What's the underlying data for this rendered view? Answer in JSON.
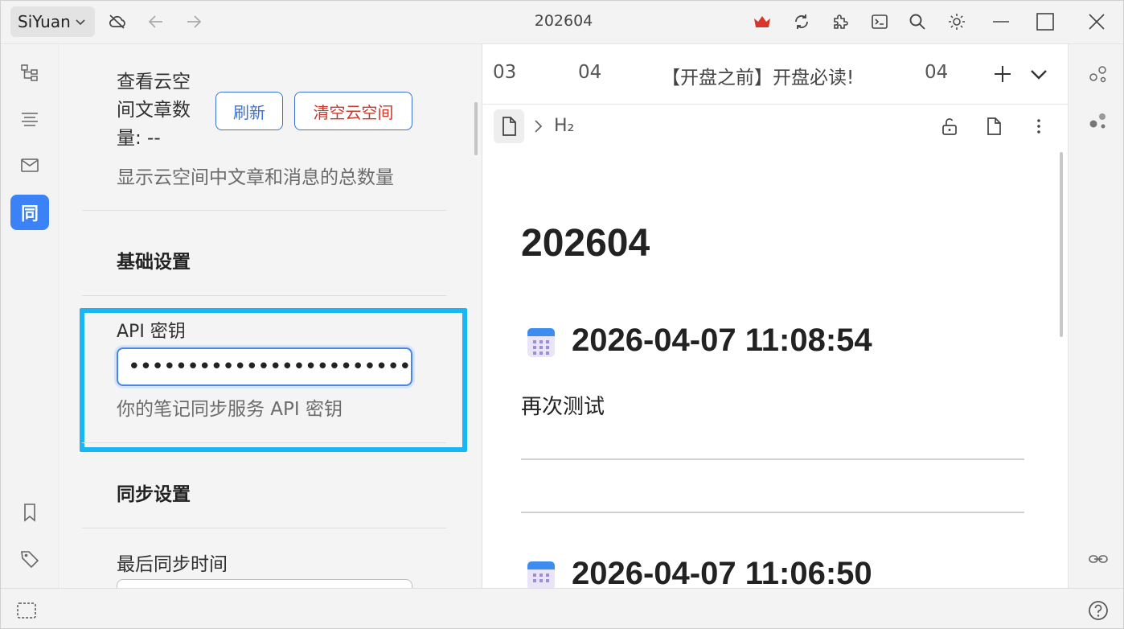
{
  "titlebar": {
    "app_name": "SiYuan",
    "title": "202604",
    "icons": [
      "cloud-off-icon",
      "back-arrow-icon",
      "forward-arrow-icon",
      "crown-icon",
      "sync-icon",
      "plugin-icon",
      "terminal-icon",
      "search-icon",
      "theme-icon",
      "minimize-icon",
      "maximize-icon",
      "close-icon"
    ]
  },
  "dock_left": {
    "items": [
      "outline-tree-icon",
      "outline-icon",
      "inbox-icon",
      "sync-plugin",
      "bookmark-icon",
      "tag-icon"
    ],
    "active_label": "同"
  },
  "settings": {
    "cloud_count_label": "查看云空间文章数量: --",
    "cloud_count_lines": [
      "查看云空",
      "间文章数",
      "量: --"
    ],
    "refresh_label": "刷新",
    "clear_label": "清空云空间",
    "cloud_count_desc": "显示云空间中文章和消息的总数量",
    "basic_section": "基础设置",
    "api_key_label": "API 密钥",
    "api_key_value": "••••••••••••••••••••••••••••",
    "api_key_desc": "你的笔记同步服务 API 密钥",
    "sync_section": "同步设置",
    "last_sync_label": "最后同步时间"
  },
  "tabs": [
    {
      "label": "03"
    },
    {
      "label": "04"
    },
    {
      "label": "【开盘之前】开盘必读!"
    },
    {
      "label": "04"
    }
  ],
  "breadcrumb": {
    "heading_label": "H₂"
  },
  "editor": {
    "title": "202604",
    "entries": [
      {
        "heading": "2026-04-07 11:08:54",
        "body": "再次测试"
      },
      {
        "heading": "2026-04-07 11:06:50"
      }
    ]
  },
  "colors": {
    "accent": "#3b82f6",
    "highlight_border": "#1ab5f5",
    "danger": "#c9382a",
    "crown": "#d9362b"
  }
}
